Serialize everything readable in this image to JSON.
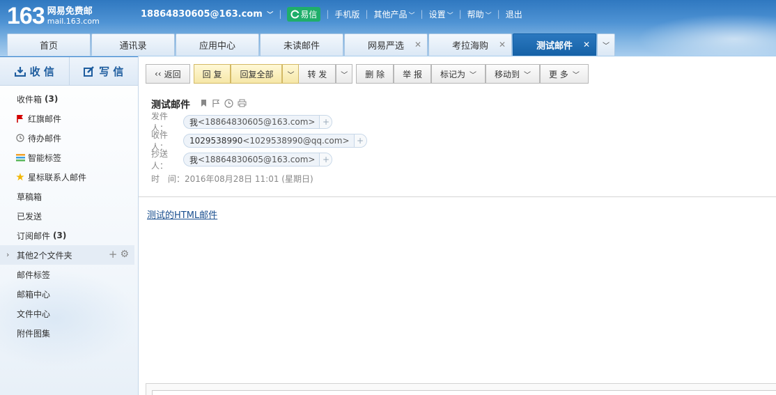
{
  "brand": {
    "number": "163",
    "name": "网易免费邮",
    "domain": "mail.163.com"
  },
  "header": {
    "account": "18864830605@163.com",
    "yixin": "易信",
    "links": [
      "手机版",
      "其他产品",
      "设置",
      "帮助",
      "退出"
    ]
  },
  "tabs": [
    {
      "label": "首页",
      "closable": false,
      "active": false
    },
    {
      "label": "通讯录",
      "closable": false,
      "active": false
    },
    {
      "label": "应用中心",
      "closable": false,
      "active": false
    },
    {
      "label": "未读邮件",
      "closable": false,
      "active": false
    },
    {
      "label": "网易严选",
      "closable": true,
      "active": false
    },
    {
      "label": "考拉海购",
      "closable": true,
      "active": false
    },
    {
      "label": "测试邮件",
      "closable": true,
      "active": true
    }
  ],
  "sidebar": {
    "receive": "收 信",
    "compose": "写 信",
    "folders": [
      {
        "label": "收件箱",
        "count": "(3)",
        "icon": ""
      },
      {
        "label": "红旗邮件",
        "count": "",
        "icon": "red-flag-icon"
      },
      {
        "label": "待办邮件",
        "count": "",
        "icon": "clock-icon"
      },
      {
        "label": "智能标签",
        "count": "",
        "icon": "tag-stack-icon"
      },
      {
        "label": "星标联系人邮件",
        "count": "",
        "icon": "star-icon"
      },
      {
        "label": "草稿箱",
        "count": "",
        "icon": ""
      },
      {
        "label": "已发送",
        "count": "",
        "icon": ""
      },
      {
        "label": "订阅邮件",
        "count": "(3)",
        "icon": ""
      },
      {
        "label": "其他2个文件夹",
        "count": "",
        "icon": "",
        "group": true
      },
      {
        "label": "邮件标签",
        "count": "",
        "icon": ""
      },
      {
        "label": "邮箱中心",
        "count": "",
        "icon": ""
      },
      {
        "label": "文件中心",
        "count": "",
        "icon": ""
      },
      {
        "label": "附件图集",
        "count": "",
        "icon": ""
      }
    ]
  },
  "toolbar": {
    "back": "返回",
    "reply": "回 复",
    "reply_all": "回复全部",
    "forward": "转 发",
    "delete": "删 除",
    "report": "举 报",
    "mark_as": "标记为",
    "move_to": "移动到",
    "more": "更 多"
  },
  "mail": {
    "subject": "测试邮件",
    "from_label": "发件人：",
    "from_name": "我",
    "from_addr": "<18864830605@163.com>",
    "to_label": "收件人：",
    "to_name": "1029538990",
    "to_addr": "<1029538990@qq.com>",
    "cc_label": "抄送人：",
    "cc_name": "我",
    "cc_addr": "<18864830605@163.com>",
    "time_label": "时　间：",
    "time_value": "2016年08月28日 11:01 (星期日)",
    "body_link": "测试的HTML邮件"
  }
}
